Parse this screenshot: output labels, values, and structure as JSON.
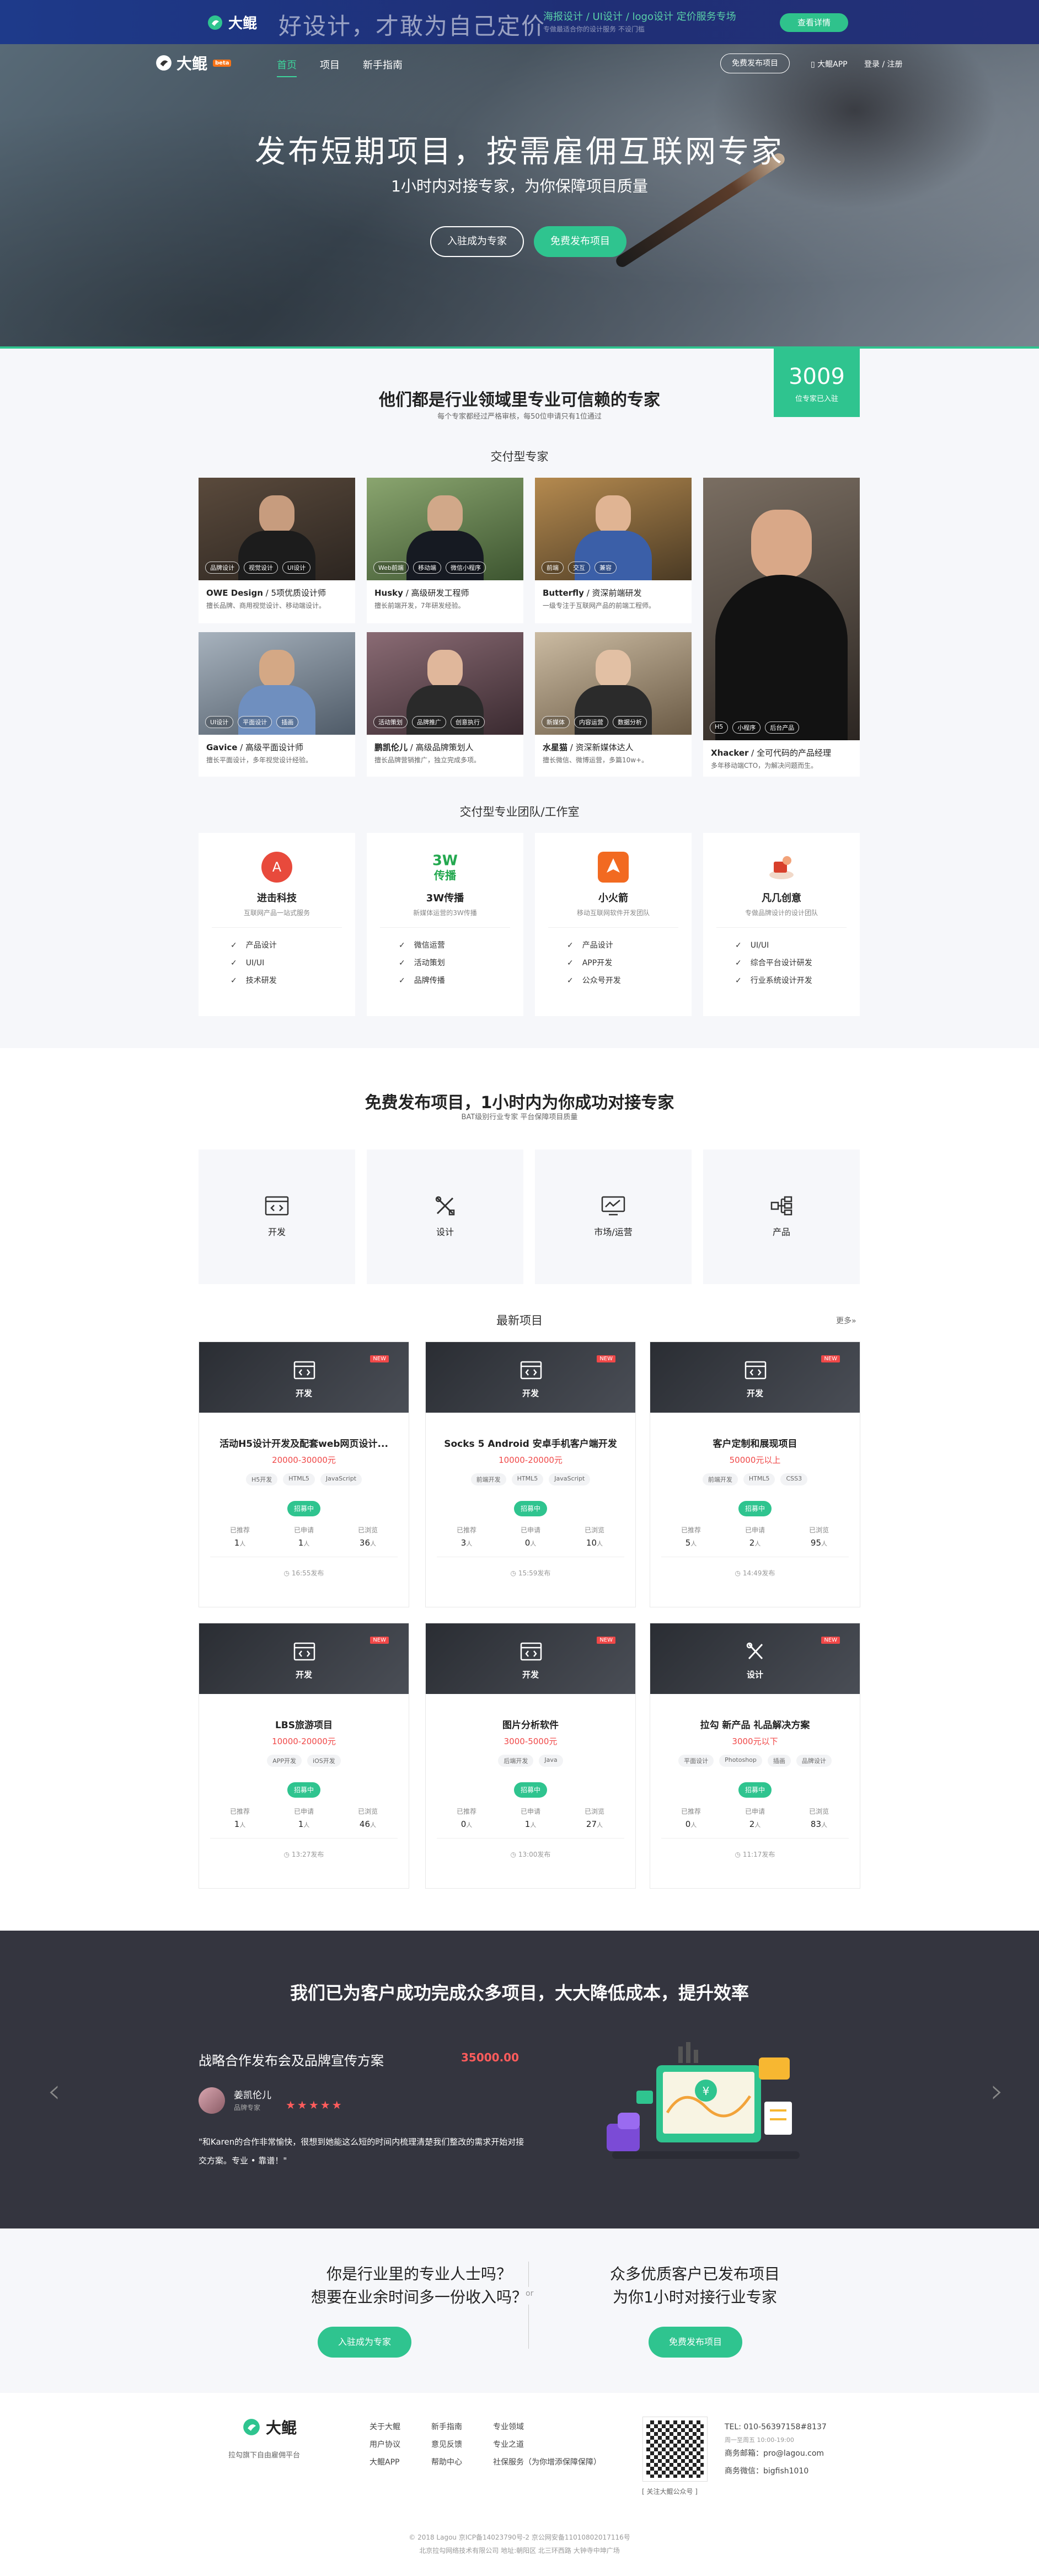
{
  "promo": {
    "logo": "大鲲",
    "slogan": "好设计，才敢为自己定价",
    "highlight": "海报设计 / UI设计 / logo设计 定价服务专场",
    "sub": "专做最适合你的设计服务 不设门槛",
    "button": "查看详情"
  },
  "nav": {
    "brand": "大鲲",
    "beta": "beta",
    "links": [
      "首页",
      "项目",
      "新手指南"
    ],
    "publish": "免费发布项目",
    "app": "大鲲APP",
    "login": "登录 / 注册"
  },
  "hero": {
    "title": "发布短期项目，按需雇佣互联网专家",
    "tagline": "1小时内对接专家，为你保障项目质量",
    "btn_join": "入驻成为专家",
    "btn_publish": "免费发布项目"
  },
  "experts": {
    "title": "他们都是行业领域里专业可信赖的专家",
    "sub": "每个专家都经过严格审核，每50位申请只有1位通过",
    "badge_num": "3009",
    "badge_text": "位专家已入驻",
    "subhead": "交付型专家",
    "cards": [
      {
        "name": "OWE Design",
        "role": " / 5项优质设计师",
        "desc": "擅长品牌、商用视觉设计、移动端设计。",
        "tags": [
          "品牌设计",
          "视觉设计",
          "UI设计"
        ]
      },
      {
        "name": "Husky",
        "role": " / 高级研发工程师",
        "desc": "擅长前端开发，7年研发经验。",
        "tags": [
          "Web前端",
          "移动端",
          "微信小程序"
        ]
      },
      {
        "name": "Butterfly",
        "role": " / 资深前端研发",
        "desc": "一级专注于互联网产品的前端工程师。",
        "tags": [
          "前端",
          "交互",
          "兼容"
        ]
      },
      {
        "name": "Xhacker",
        "role": " / 全可代码的产品经理",
        "desc": "多年移动端CTO，为解决问题而生。",
        "tags": [
          "H5",
          "小程序",
          "后台产品"
        ]
      },
      {
        "name": "Gavice",
        "role": " / 高级平面设计师",
        "desc": "擅长平面设计，多年视觉设计经验。",
        "tags": [
          "UI设计",
          "平面设计",
          "插画"
        ]
      },
      {
        "name": "鹏凯伦儿",
        "role": " / 高级品牌策划人",
        "desc": "擅长品牌营销推广，独立完成多项。",
        "tags": [
          "活动策划",
          "品牌推广",
          "创意执行"
        ]
      },
      {
        "name": "水星猫",
        "role": " / 资深新媒体达人",
        "desc": "擅长微信、微博运营，多篇10w+。",
        "tags": [
          "新媒体",
          "内容运营",
          "数据分析"
        ]
      }
    ],
    "team_head": "交付型专业团队/工作室",
    "teams": [
      {
        "name": "进击科技",
        "desc": "互联网产品一站式服务",
        "items": [
          "产品设计",
          "UI/UI",
          "技术研发"
        ]
      },
      {
        "name": "3W传播",
        "desc": "新媒体运营的3W传播",
        "items": [
          "微信运营",
          "活动策划",
          "品牌传播"
        ]
      },
      {
        "name": "小火箭",
        "desc": "移动互联网软件开发团队",
        "items": [
          "产品设计",
          "APP开发",
          "公众号开发"
        ]
      },
      {
        "name": "凡几创意",
        "desc": "专做品牌设计的设计团队",
        "items": [
          "UI/UI",
          "综合平台设计研发",
          "行业系统设计开发"
        ]
      }
    ]
  },
  "projects": {
    "title": "免费发布项目，1小时内为你成功对接专家",
    "sub": "BAT级别行业专家 平台保障项目质量",
    "categories": [
      "开发",
      "设计",
      "市场/运营",
      "产品"
    ],
    "latest": "最新项目",
    "more": "更多»",
    "status": "招募中",
    "stat_labels": [
      "已推荐",
      "已申请",
      "已浏览"
    ],
    "unit": "人",
    "items": [
      {
        "cat": "开发",
        "title": "活动H5设计开发及配套web网页设计...",
        "price": "20000-30000元",
        "tags": [
          "H5开发",
          "HTML5",
          "JavaScript"
        ],
        "rec": "1",
        "app": "1",
        "view": "36",
        "time": "16:55发布",
        "new": true
      },
      {
        "cat": "开发",
        "title": "Socks 5 Android 安卓手机客户端开发",
        "price": "10000-20000元",
        "tags": [
          "前端开发",
          "HTML5",
          "JavaScript"
        ],
        "rec": "3",
        "app": "0",
        "view": "10",
        "time": "15:59发布",
        "new": true
      },
      {
        "cat": "开发",
        "title": "客户定制和展现项目",
        "price": "50000元以上",
        "tags": [
          "前端开发",
          "HTML5",
          "CSS3"
        ],
        "rec": "5",
        "app": "2",
        "view": "95",
        "time": "14:49发布",
        "new": true
      },
      {
        "cat": "开发",
        "title": "LBS旅游项目",
        "price": "10000-20000元",
        "tags": [
          "APP开发",
          "iOS开发"
        ],
        "rec": "1",
        "app": "1",
        "view": "46",
        "time": "13:27发布",
        "new": true
      },
      {
        "cat": "开发",
        "title": "图片分析软件",
        "price": "3000-5000元",
        "tags": [
          "后端开发",
          "Java"
        ],
        "rec": "0",
        "app": "1",
        "view": "27",
        "time": "13:00发布",
        "new": true
      },
      {
        "cat": "设计",
        "title": "拉勾 新产品 礼品解决方案",
        "price": "3000元以下",
        "tags": [
          "平面设计",
          "Photoshop",
          "插画",
          "品牌设计"
        ],
        "rec": "0",
        "app": "2",
        "view": "83",
        "time": "11:17发布",
        "new": true
      }
    ]
  },
  "cases": {
    "title": "我们已为客户成功完成众多项目，大大降低成本，提升效率",
    "case_title": "战略合作发布会及品牌宣传方案",
    "price": "35000.00",
    "author": "姜凯伦儿",
    "role": "品牌专家",
    "stars": "★★★★★",
    "quote": "\"和Karen的合作非常愉快，很想到她能这么短的时间内梳理清楚我们整改的需求开始对接交方案。专业 • 靠谱！\""
  },
  "cta": {
    "left_q1": "你是行业里的专业人士吗？",
    "left_q2": "想要在业余时间多一份收入吗？",
    "left_btn": "入驻成为专家",
    "or": "or",
    "right_q1": "众多优质客户已发布项目",
    "right_q2": "为你1小时对接行业专家",
    "right_btn": "免费发布项目"
  },
  "footer": {
    "logo": "大鲲",
    "slogan": "拉勾旗下自由雇佣平台",
    "col1": [
      "关于大鲲",
      "用户协议",
      "大鲲APP"
    ],
    "col2": [
      "新手指南",
      "意见反馈",
      "帮助中心"
    ],
    "col3": [
      "专业领域",
      "专业之道",
      "社保服务（为你增添保障保障）"
    ],
    "qr_label": "[ 关注大鲲公众号 ]",
    "contacts": [
      "TEL: 010-56397158#8137",
      "周一至周五 10:00-19:00",
      "商务邮箱：pro@lagou.com",
      "商务微信：bigfish1010"
    ],
    "copyright": "© 2018 Lagou 京ICP备14023790号-2 京公网安备11010802017116号",
    "copyright2": "北京拉勾网络技术有限公司 地址:朝阳区 北三环西路 大钟寺中坤广场"
  }
}
